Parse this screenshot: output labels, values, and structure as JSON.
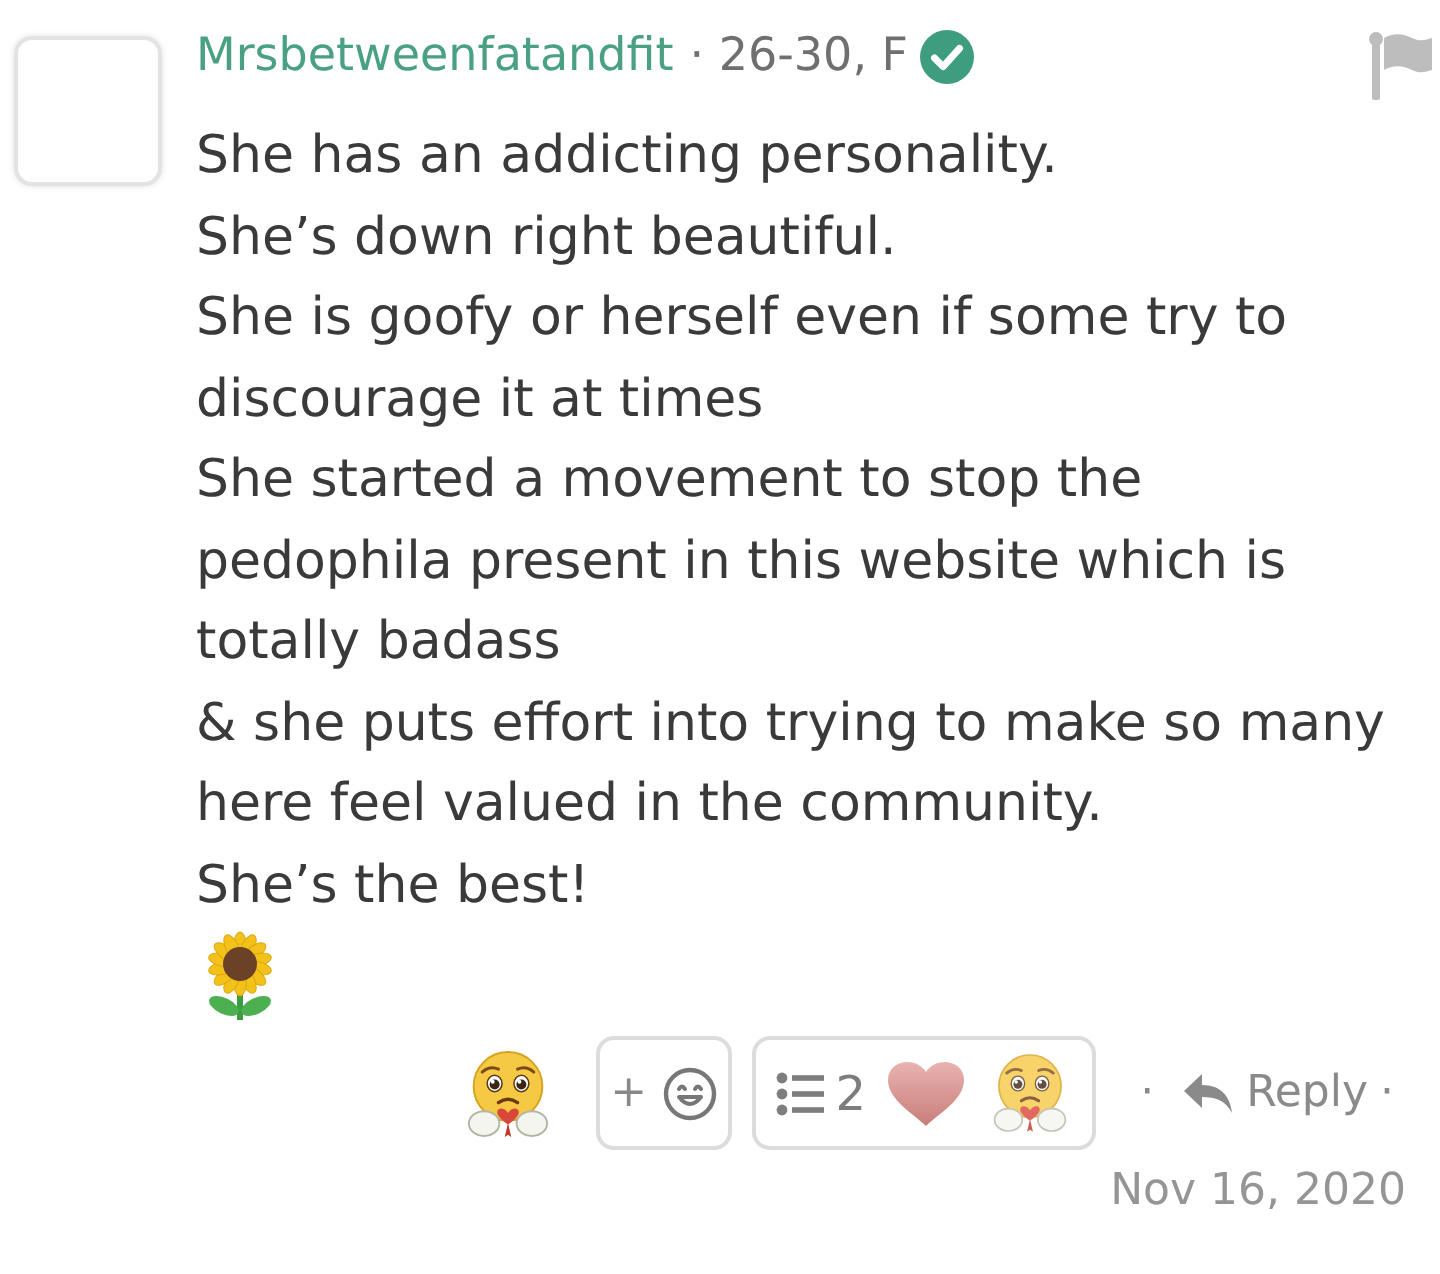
{
  "post": {
    "author": {
      "name": "Mrsbetweenfatandfit",
      "details": "· 26-30, F",
      "verified": true
    },
    "body": "She has an addicting personality.\nShe’s down right beautiful.\nShe is goofy or herself even if some try to discourage it at times\nShe started a movement to stop the pedophila present in this website which is totally badass\n& she puts effort into trying to make so many here feel valued in the community.\nShe’s the best!",
    "add_reaction": {
      "symbol": "+"
    },
    "reactions": {
      "count": "2"
    },
    "reply": {
      "separator_before": "·",
      "label": "Reply",
      "separator_after": "·"
    },
    "date": "Nov 16, 2020"
  }
}
